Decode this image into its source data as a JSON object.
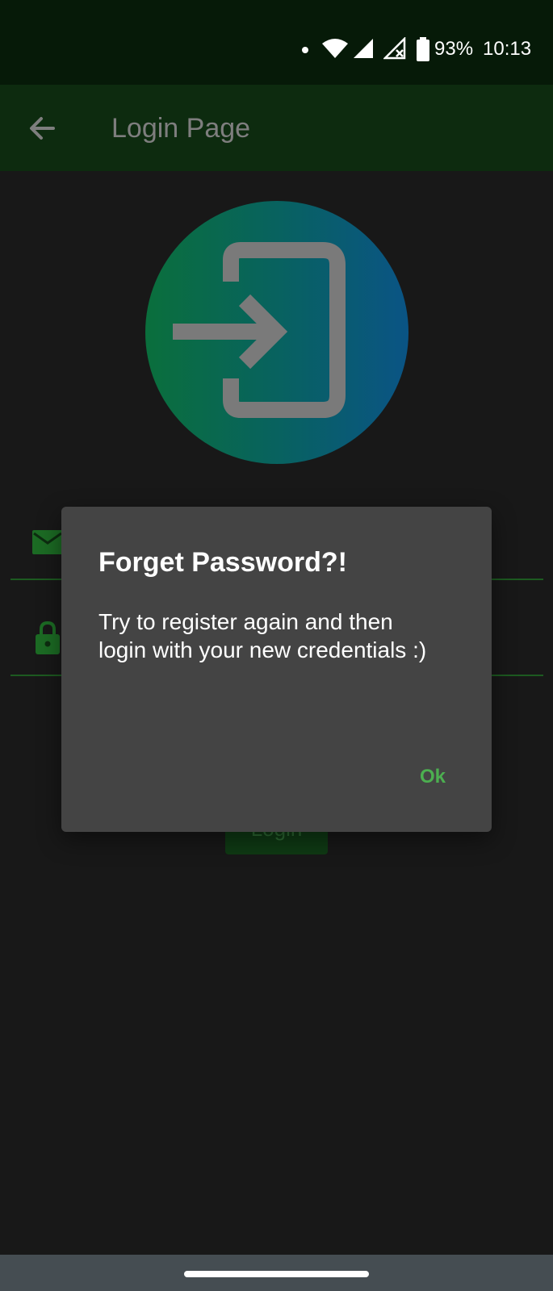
{
  "status_bar": {
    "battery_percent": "93%",
    "time": "10:13",
    "icons": [
      "notification-dot-icon",
      "wifi-icon",
      "cell-signal-icon",
      "no-signal-icon",
      "battery-icon"
    ]
  },
  "app_bar": {
    "title": "Login Page",
    "back_icon": "arrow-back-icon"
  },
  "login_form": {
    "logo_icon": "login-enter-icon",
    "email_icon": "email-icon",
    "password_icon": "lock-icon",
    "login_button_label": "Login"
  },
  "dialog": {
    "title": "Forget Password?!",
    "message": "Try to register again and then login with your new credentials :)",
    "ok_label": "Ok"
  },
  "colors": {
    "status_bar": "#061a08",
    "app_bar": "#0d2b0f",
    "background": "#181818",
    "dialog": "#444444",
    "accent": "#4caf50"
  }
}
